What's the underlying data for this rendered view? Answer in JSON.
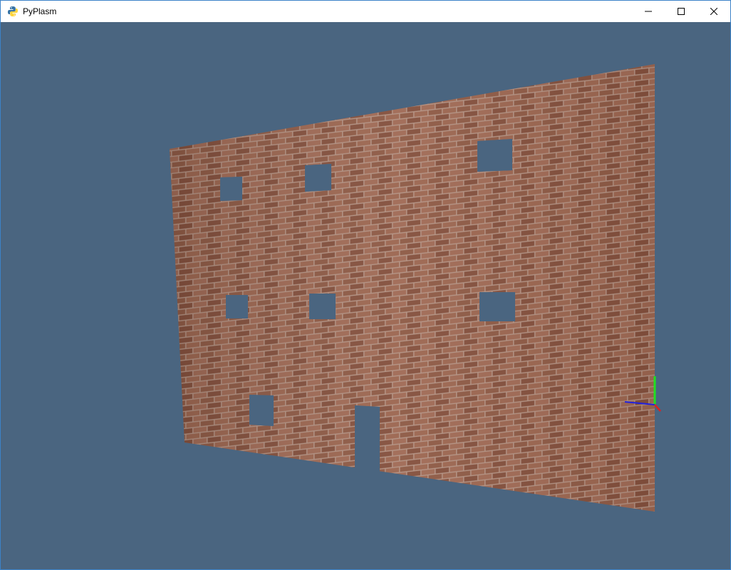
{
  "window": {
    "title": "PyPlasm",
    "app_icon": "python-icon",
    "controls": [
      {
        "name": "minimize-button",
        "icon": "minimize-icon"
      },
      {
        "name": "maximize-button",
        "icon": "maximize-icon"
      },
      {
        "name": "close-button",
        "icon": "close-icon"
      }
    ]
  },
  "colors": {
    "background": "#4a6580",
    "brick": "#8e5a45",
    "mortar": "#b39283",
    "axis_x": "#e02020",
    "axis_y": "#20e020",
    "axis_z": "#2020e0"
  },
  "scene": {
    "object": "brick-wall",
    "openings": [
      "window",
      "window",
      "window",
      "window",
      "window",
      "window",
      "window",
      "door"
    ],
    "axes": [
      "x-axis",
      "y-axis",
      "z-axis"
    ]
  }
}
